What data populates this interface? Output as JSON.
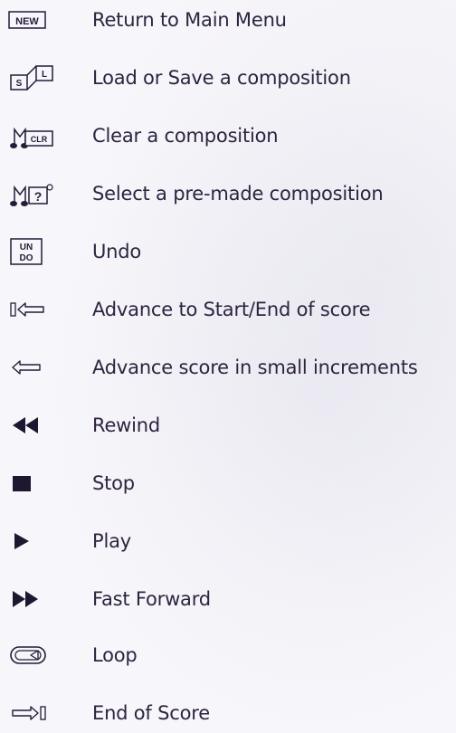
{
  "legend": {
    "items": [
      {
        "icon": "new-icon",
        "icon_text": "NEW",
        "label": "Return to Main Menu"
      },
      {
        "icon": "load-save-icon",
        "icon_text": "S L",
        "label": "Load or Save a composition"
      },
      {
        "icon": "clear-composition-icon",
        "icon_text": "CLR",
        "label": "Clear a composition"
      },
      {
        "icon": "premade-composition-icon",
        "icon_text": "?",
        "label": "Select a pre-made composition"
      },
      {
        "icon": "undo-icon",
        "icon_text": "UN DO",
        "label": "Undo"
      },
      {
        "icon": "start-end-icon",
        "label": "Advance to Start/End of score"
      },
      {
        "icon": "small-increment-icon",
        "label": "Advance score in small increments"
      },
      {
        "icon": "rewind-icon",
        "label": "Rewind"
      },
      {
        "icon": "stop-icon",
        "label": "Stop"
      },
      {
        "icon": "play-icon",
        "label": "Play"
      },
      {
        "icon": "fast-forward-icon",
        "label": "Fast Forward"
      },
      {
        "icon": "loop-icon",
        "label": "Loop"
      },
      {
        "icon": "end-of-score-icon",
        "label": "End of Score"
      }
    ]
  }
}
